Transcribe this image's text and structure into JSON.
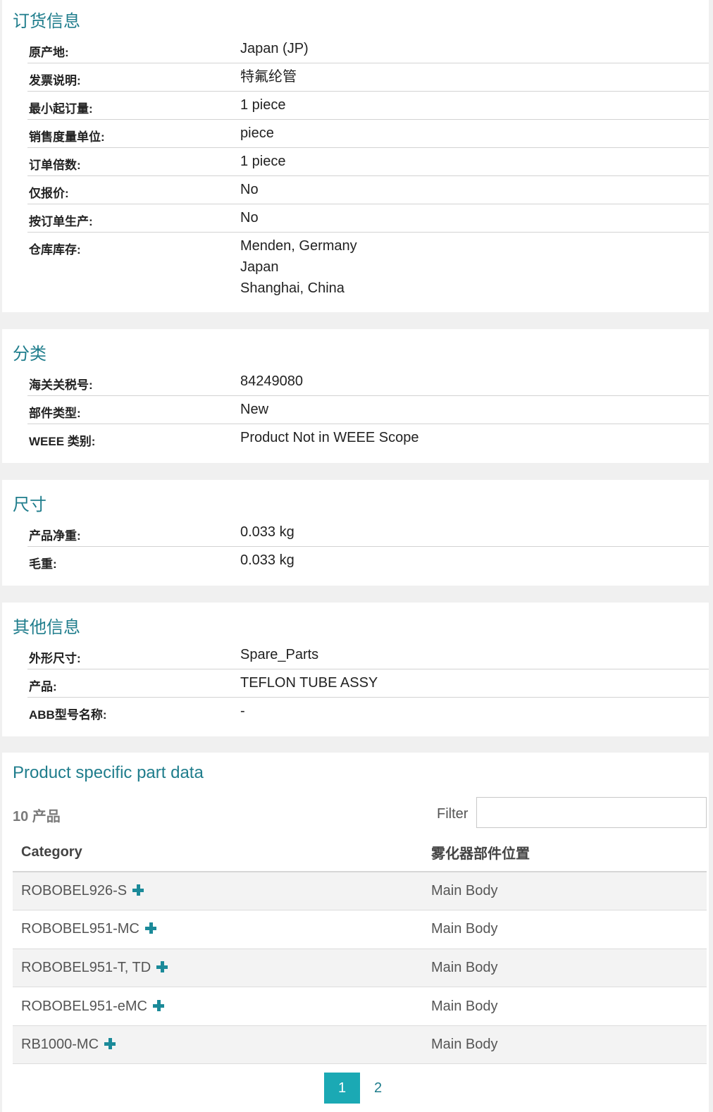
{
  "ordering": {
    "title": "订货信息",
    "rows": [
      {
        "label": "原产地:",
        "value": "Japan (JP)"
      },
      {
        "label": "发票说明:",
        "value": "特氟纶管"
      },
      {
        "label": "最小起订量:",
        "value": "1 piece"
      },
      {
        "label": "销售度量单位:",
        "value": "piece"
      },
      {
        "label": "订单倍数:",
        "value": "1 piece"
      },
      {
        "label": "仅报价:",
        "value": "No"
      },
      {
        "label": "按订单生产:",
        "value": "No"
      }
    ],
    "warehouse": {
      "label": "仓库库存:",
      "values": [
        "Menden, Germany",
        "Japan",
        "Shanghai, China"
      ]
    }
  },
  "classification": {
    "title": "分类",
    "rows": [
      {
        "label": "海关关税号:",
        "value": "84249080"
      },
      {
        "label": "部件类型:",
        "value": "New"
      },
      {
        "label": "WEEE 类别:",
        "value": "Product Not in WEEE Scope"
      }
    ]
  },
  "dimensions": {
    "title": "尺寸",
    "rows": [
      {
        "label": "产品净重:",
        "value": "0.033 kg"
      },
      {
        "label": "毛重:",
        "value": "0.033 kg"
      }
    ]
  },
  "other": {
    "title": "其他信息",
    "rows": [
      {
        "label": "外形尺寸:",
        "value": "Spare_Parts"
      },
      {
        "label": "产品:",
        "value": "TEFLON TUBE ASSY"
      },
      {
        "label": "ABB型号名称:",
        "value": "-"
      }
    ]
  },
  "parts": {
    "title": "Product specific part data",
    "count": "10 产品",
    "filter_label": "Filter",
    "filter_value": "",
    "columns": [
      "Category",
      "雾化器部件位置"
    ],
    "rows": [
      {
        "category": "ROBOBEL926-S",
        "position": "Main Body"
      },
      {
        "category": "ROBOBEL951-MC",
        "position": "Main Body"
      },
      {
        "category": "ROBOBEL951-T, TD",
        "position": "Main Body"
      },
      {
        "category": "ROBOBEL951-eMC",
        "position": "Main Body"
      },
      {
        "category": "RB1000-MC",
        "position": "Main Body"
      }
    ],
    "pages": [
      "1",
      "2"
    ],
    "current_page": "1"
  },
  "colors": {
    "accent": "#1f7d8c",
    "active_page": "#1ba9b4",
    "plus_icon": "#1b8a99"
  }
}
